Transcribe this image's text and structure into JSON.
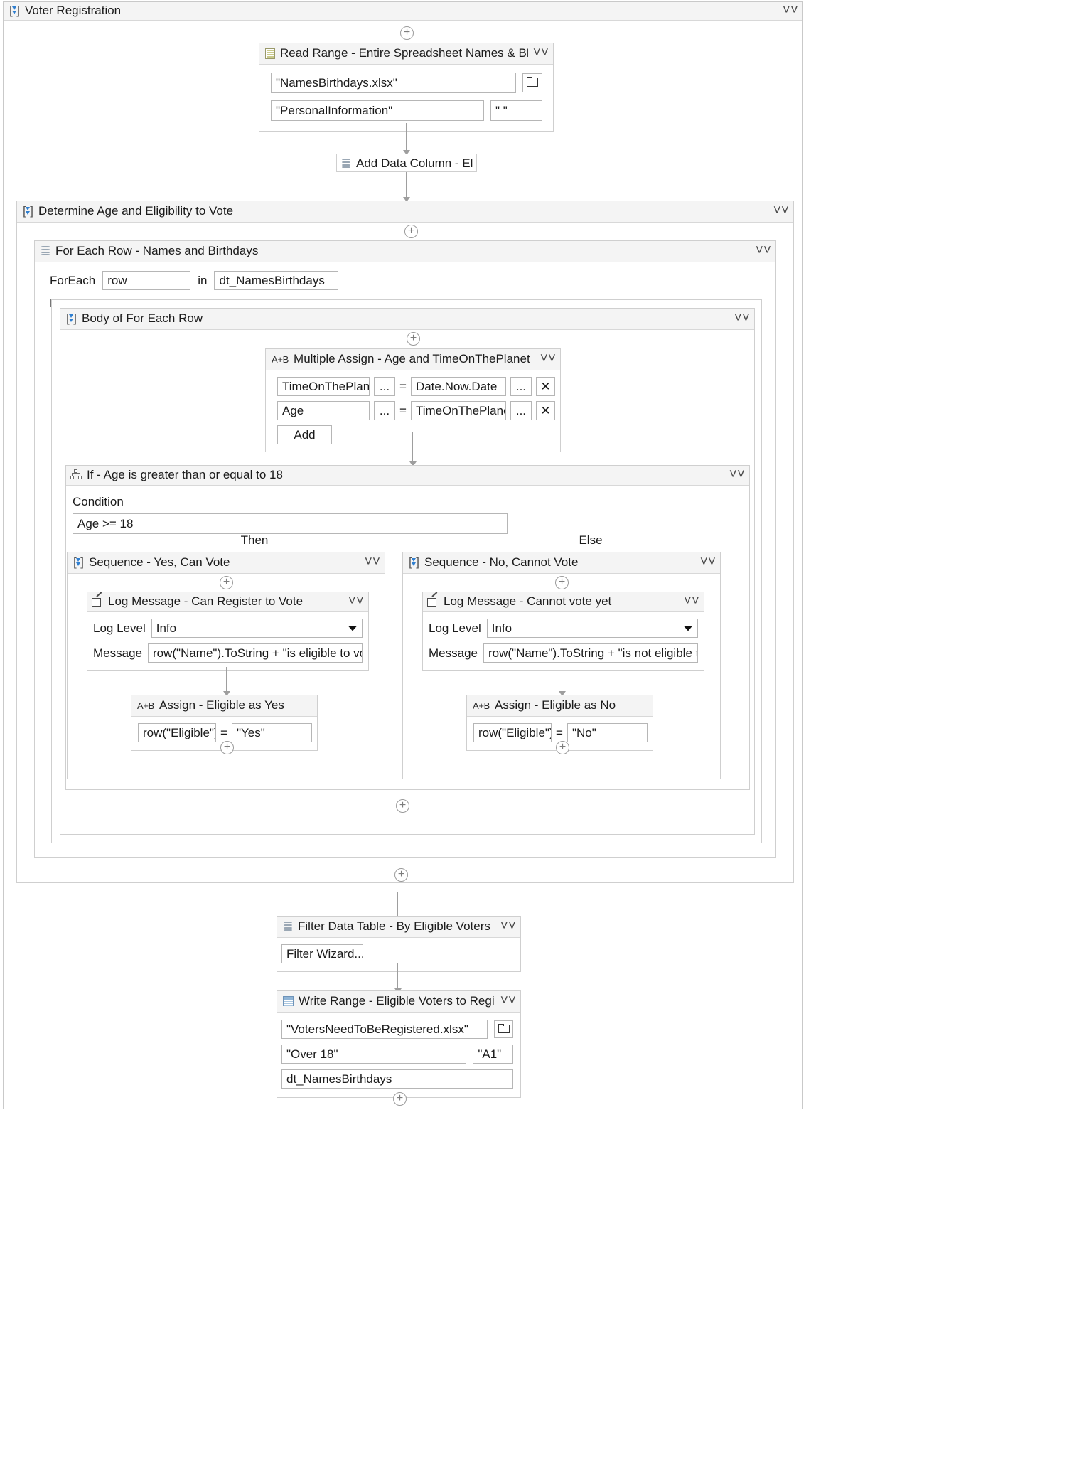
{
  "workflow": {
    "root": {
      "title": "Voter Registration",
      "icon": "sequence-icon",
      "collapse_icon": "chevron-up-icon"
    },
    "read_range": {
      "title": "Read Range - Entire Spreadsheet Names & BDays",
      "icon": "excel-icon",
      "workbook_path": "\"NamesBirthdays.xlsx\"",
      "browse_icon": "folder-icon",
      "sheet_name": "\"PersonalInformation\"",
      "range": "\" \""
    },
    "add_data_column": {
      "title": "Add Data Column - Eligib",
      "icon": "data-table-icon"
    },
    "determine_scope": {
      "title": "Determine Age and Eligibility to Vote",
      "icon": "sequence-icon"
    },
    "for_each_row": {
      "title": "For Each Row - Names and Birthdays",
      "icon": "data-table-icon",
      "foreach_label": "ForEach",
      "item_variable": "row",
      "in_label": "in",
      "collection": "dt_NamesBirthdays",
      "body_label": "Body"
    },
    "body_sequence": {
      "title": "Body of For Each Row",
      "icon": "sequence-icon"
    },
    "multiple_assign": {
      "title": "Multiple Assign - Age and TimeOnThePlanet",
      "icon": "assign-icon",
      "icon_text": "A+B",
      "ellipsis": "...",
      "equals": "=",
      "remove": "✕",
      "add_label": "Add",
      "rows": [
        {
          "to": "TimeOnThePlanet",
          "value": "Date.Now.Date"
        },
        {
          "to": "Age",
          "value": "TimeOnThePlanet"
        }
      ]
    },
    "if_activity": {
      "title": "If - Age is greater than or equal to 18",
      "icon": "if-icon",
      "condition_label": "Condition",
      "condition": "Age >= 18",
      "then_label": "Then",
      "else_label": "Else"
    },
    "then_branch": {
      "sequence_title": "Sequence - Yes, Can Vote",
      "sequence_icon": "sequence-icon",
      "log_message": {
        "title": "Log Message - Can Register to Vote",
        "icon": "log-message-icon",
        "log_level_label": "Log Level",
        "log_level_value": "Info",
        "dropdown_icon": "chevron-down-icon",
        "message_label": "Message",
        "message_value": "row(\"Name\").ToString + \"is eligible to vote"
      },
      "assign": {
        "title": "Assign - Eligible as Yes",
        "icon_text": "A+B",
        "to": "row(\"Eligible\")",
        "equals": "=",
        "value": "\"Yes\""
      }
    },
    "else_branch": {
      "sequence_title": "Sequence - No, Cannot Vote",
      "sequence_icon": "sequence-icon",
      "log_message": {
        "title": "Log Message - Cannot vote yet",
        "icon": "log-message-icon",
        "log_level_label": "Log Level",
        "log_level_value": "Info",
        "dropdown_icon": "chevron-down-icon",
        "message_label": "Message",
        "message_value": "row(\"Name\").ToString + \"is not eligible to"
      },
      "assign": {
        "title": "Assign - Eligible as  No",
        "icon_text": "A+B",
        "to": "row(\"Eligible\")",
        "equals": "=",
        "value": "\"No\""
      }
    },
    "filter_data_table": {
      "title": "Filter Data Table - By Eligible Voters",
      "icon": "data-table-icon",
      "wizard_button": "Filter Wizard..."
    },
    "write_range": {
      "title": "Write Range - Eligible Voters to Register",
      "icon": "write-range-icon",
      "workbook_path": "\"VotersNeedToBeRegistered.xlsx\"",
      "browse_icon": "folder-icon",
      "sheet_name": "\"Over 18\"",
      "range": "\"A1\"",
      "data_table": "dt_NamesBirthdays"
    }
  },
  "colors": {
    "accent": "#2f7fd0",
    "header_bg": "#f4f4f4",
    "border": "#cfcfcf",
    "connector": "#9e9e9e"
  }
}
